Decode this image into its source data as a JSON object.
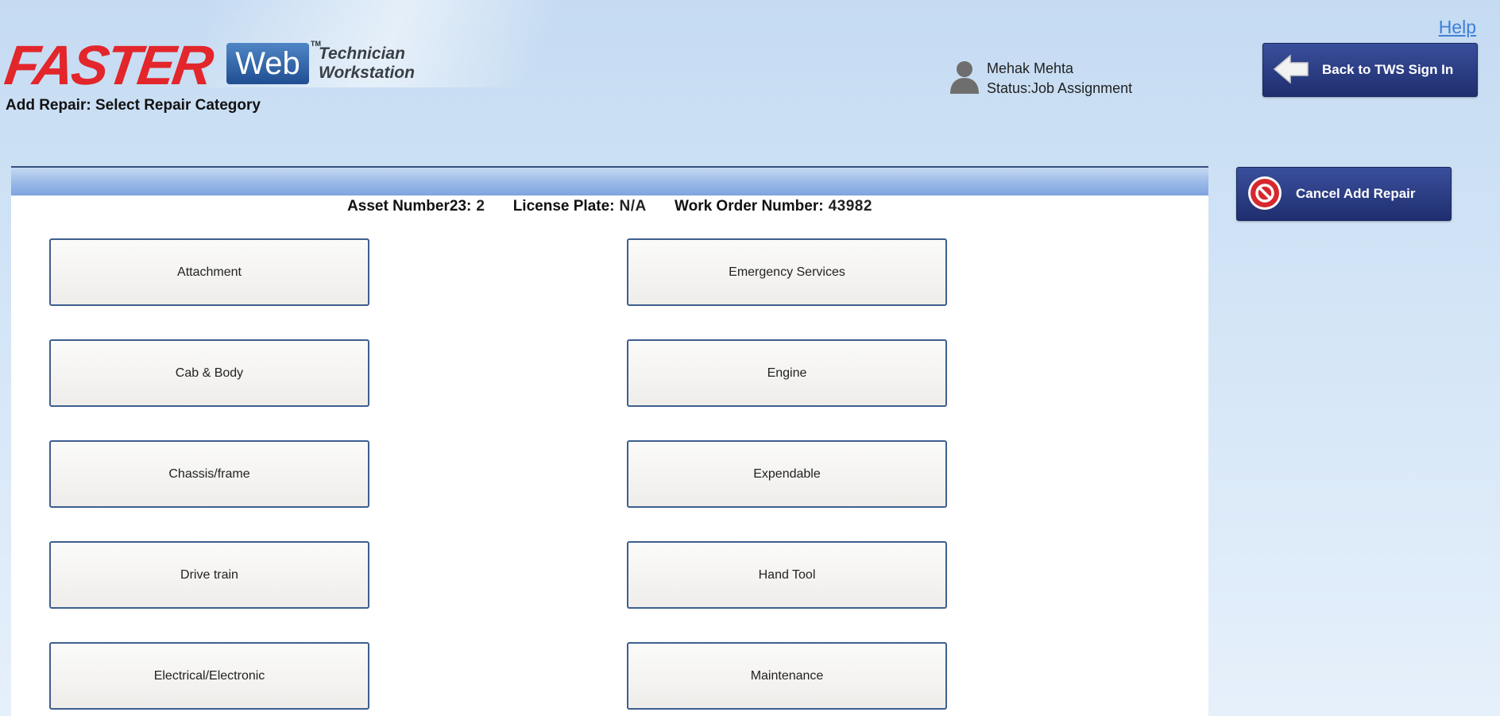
{
  "header": {
    "logo_brand": "FASTER",
    "logo_web": "Web",
    "logo_tm": "TM",
    "logo_subtitle_line1": "Technician",
    "logo_subtitle_line2": "Workstation",
    "page_title": "Add Repair: Select Repair Category",
    "help_link": "Help"
  },
  "user": {
    "name": "Mehak Mehta",
    "status": "Status:Job Assignment",
    "icon": "user-icon"
  },
  "actions": {
    "back_label": "Back to TWS Sign In",
    "back_icon": "arrow-left-icon",
    "cancel_label": "Cancel Add Repair",
    "cancel_icon": "cancel-icon"
  },
  "info": {
    "asset_label": "Asset Number23:",
    "asset_value": "2",
    "plate_label": "License Plate:",
    "plate_value": "N/A",
    "wo_label": "Work Order Number:",
    "wo_value": "43982"
  },
  "categories": {
    "left": [
      "Attachment",
      "Cab & Body",
      "Chassis/frame",
      "Drive train",
      "Electrical/Electronic"
    ],
    "right": [
      "Emergency Services",
      "Engine",
      "Expendable",
      "Hand Tool",
      "Maintenance"
    ]
  },
  "colors": {
    "brand_red": "#e2262b",
    "button_navy": "#26357a",
    "link_blue": "#3f7fd8",
    "category_border": "#3d5f8f"
  }
}
